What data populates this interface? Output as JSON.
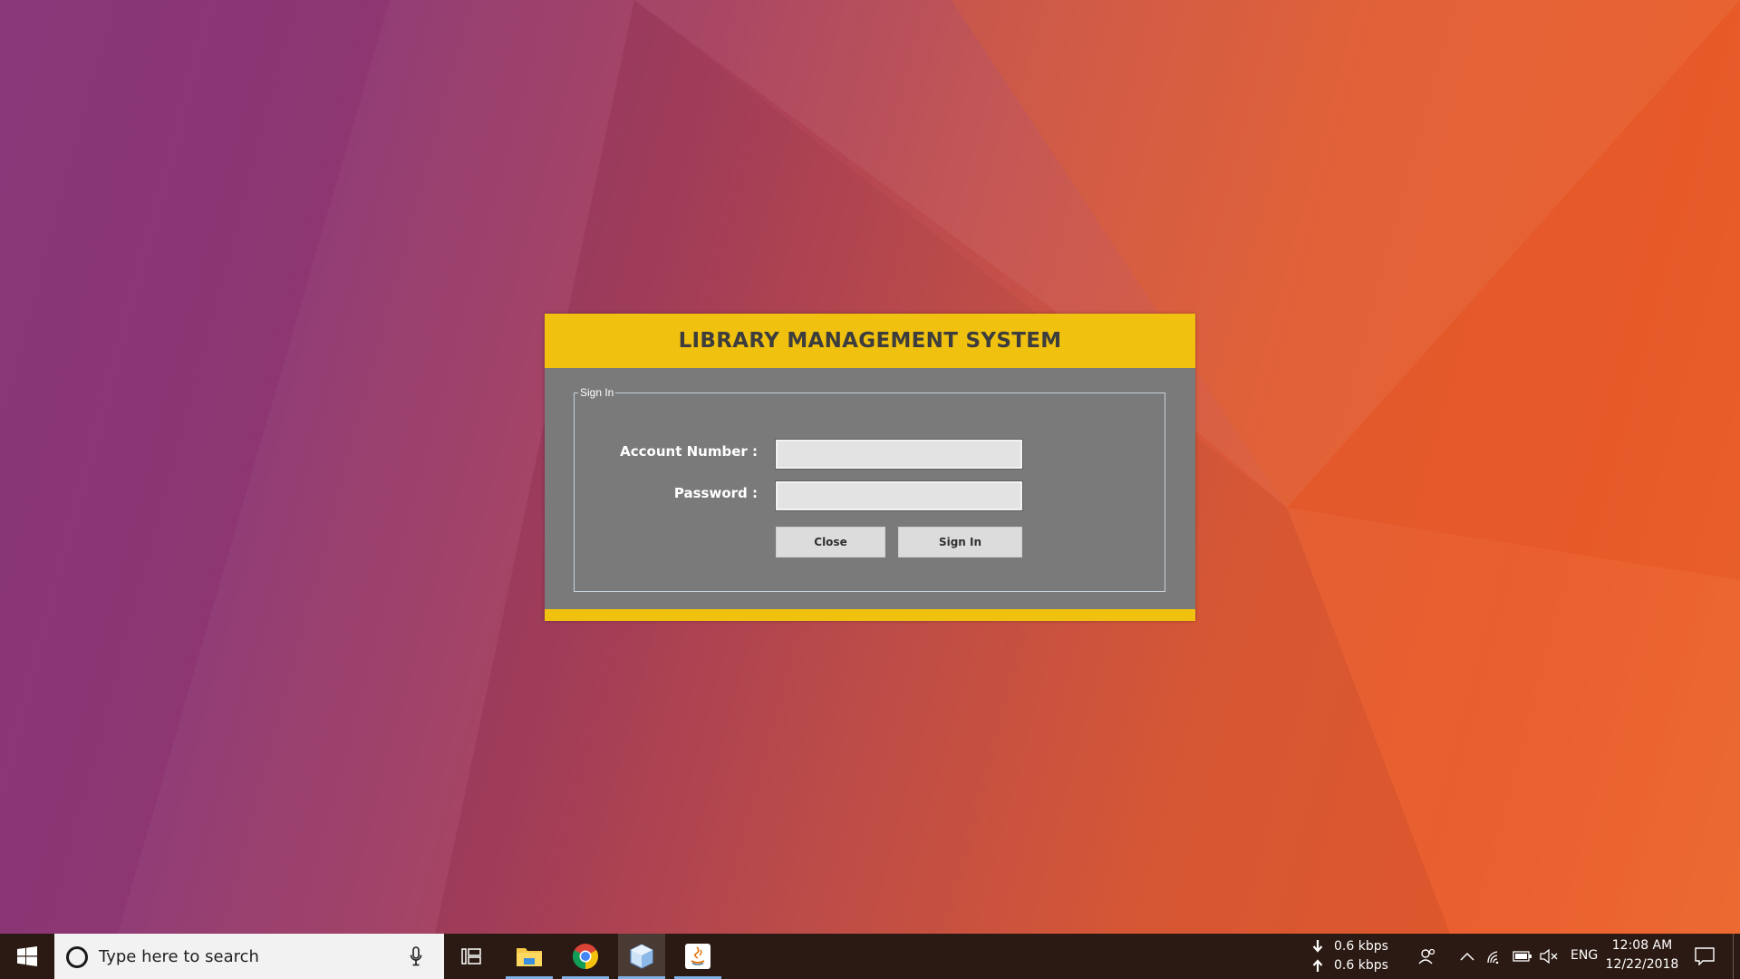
{
  "app": {
    "title": "LIBRARY MANAGEMENT SYSTEM",
    "group_title": "Sign In",
    "account_label": "Account Number :",
    "account_value": "",
    "password_label": "Password :",
    "password_value": "",
    "close_label": "Close",
    "signin_label": "Sign In"
  },
  "taskbar": {
    "search_placeholder": "Type here to search",
    "apps": [
      "file-explorer-icon",
      "chrome-icon",
      "virtualbox-icon",
      "java-icon"
    ],
    "download_speed": "0.6 kbps",
    "upload_speed": "0.6 kbps",
    "language": "ENG",
    "time": "12:08 AM",
    "date": "12/22/2018"
  },
  "colors": {
    "header": "#f0c20f",
    "panel": "#7a7a7a",
    "taskbar": "#2b1a13"
  }
}
